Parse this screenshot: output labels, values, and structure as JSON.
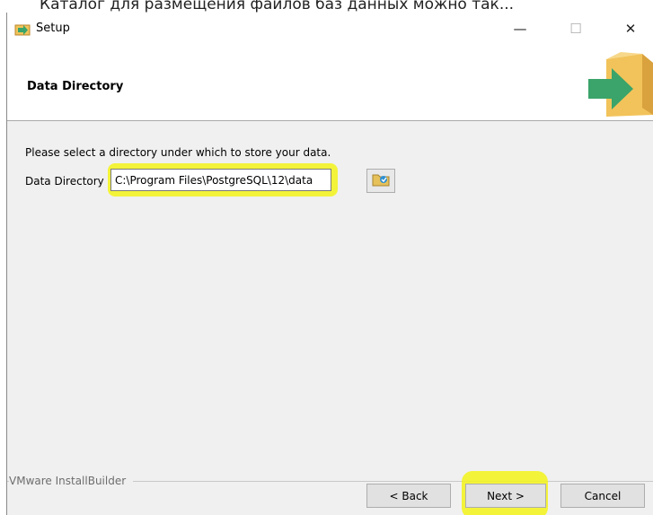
{
  "caption": "Каталог для размещения файлов баз данных можно так...",
  "window": {
    "title": "Setup",
    "minimize_glyph": "—",
    "maximize_glyph": "☐",
    "close_glyph": "✕"
  },
  "header": {
    "page_title": "Data Directory"
  },
  "content": {
    "instruction": "Please select a directory under which to store your data.",
    "field_label": "Data Directory",
    "field_value": "C:\\Program Files\\PostgreSQL\\12\\data"
  },
  "footer": {
    "group_label": "VMware InstallBuilder",
    "back_label": "< Back",
    "next_label": "Next >",
    "cancel_label": "Cancel"
  },
  "colors": {
    "highlight": "#f3f31a",
    "logo_box": "#f2c35a",
    "logo_arrow": "#3aa46a"
  },
  "icons": [
    "setup-app-icon",
    "folder-browse-icon",
    "installer-box-logo"
  ]
}
